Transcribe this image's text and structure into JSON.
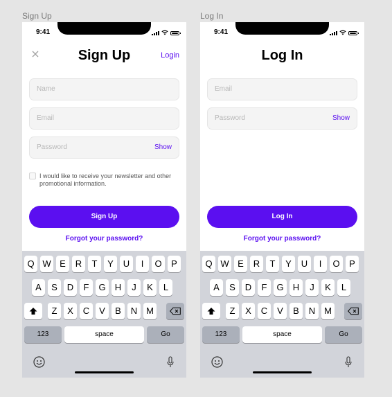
{
  "frames": {
    "signup_label": "Sign Up",
    "login_label": "Log In"
  },
  "status_bar": {
    "time": "9:41"
  },
  "signup": {
    "title": "Sign Up",
    "header_link": "Login",
    "name_placeholder": "Name",
    "email_placeholder": "Email",
    "password_placeholder": "Password",
    "show_label": "Show",
    "newsletter_text": "I would like to receive your newsletter and other promotional information.",
    "submit_label": "Sign Up",
    "forgot_label": "Forgot your password?"
  },
  "login": {
    "title": "Log In",
    "email_placeholder": "Email",
    "password_placeholder": "Password",
    "show_label": "Show",
    "submit_label": "Log In",
    "forgot_label": "Forgot your password?"
  },
  "keyboard": {
    "row1": [
      "Q",
      "W",
      "E",
      "R",
      "T",
      "Y",
      "U",
      "I",
      "O",
      "P"
    ],
    "row2": [
      "A",
      "S",
      "D",
      "F",
      "G",
      "H",
      "J",
      "K",
      "L"
    ],
    "row3": [
      "Z",
      "X",
      "C",
      "V",
      "B",
      "N",
      "M"
    ],
    "numbers_label": "123",
    "space_label": "space",
    "go_label": "Go",
    "icons": [
      "shift-icon",
      "backspace-icon",
      "emoji-icon",
      "microphone-icon"
    ]
  },
  "colors": {
    "accent": "#5b0ff0",
    "keyboard_bg": "#d2d4da",
    "key_bg": "#ffffff",
    "key_dark_bg": "#abb0ba",
    "field_bg": "#f4f4f4"
  }
}
